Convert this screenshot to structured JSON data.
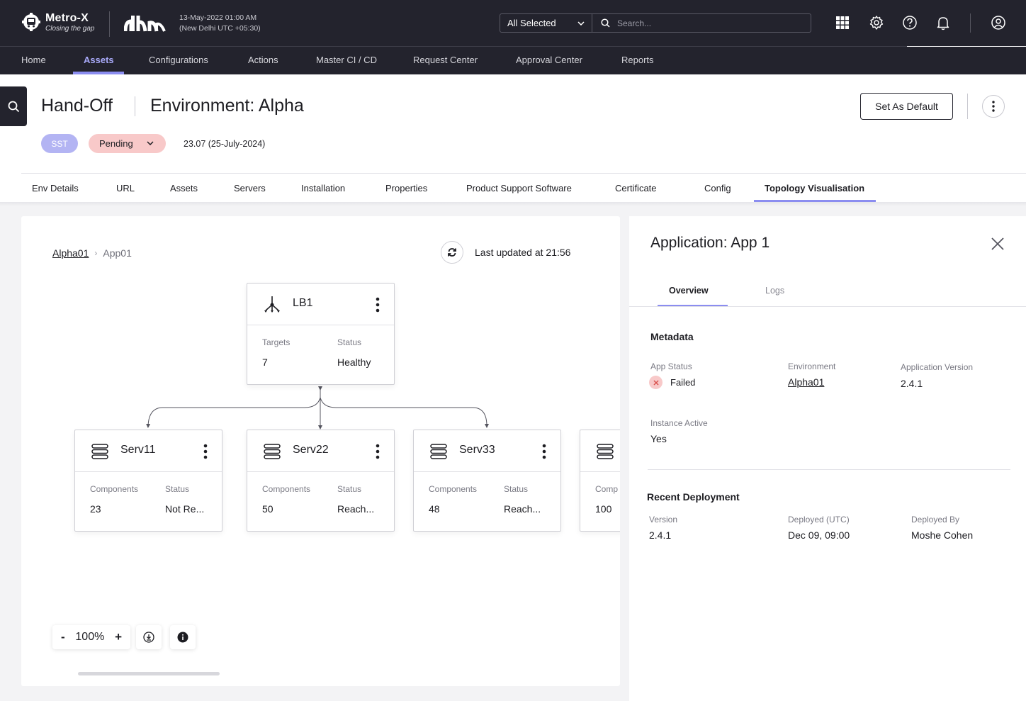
{
  "app": {
    "name": "Metro-X",
    "tagline": "Closing the gap",
    "datetime_line1": "13-May-2022 01:00 AM",
    "datetime_line2": "(New Delhi UTC +05:30)"
  },
  "search": {
    "scope_value": "All Selected",
    "placeholder": "Search..."
  },
  "top_icons": [
    "grid-icon",
    "gear-icon",
    "help-icon",
    "bell-icon",
    "user-icon"
  ],
  "nav": {
    "items": [
      {
        "label": "Home"
      },
      {
        "label": "Assets",
        "active": true
      },
      {
        "label": "Configurations"
      },
      {
        "label": "Actions"
      },
      {
        "label": "Master CI / CD"
      },
      {
        "label": "Request Center"
      },
      {
        "label": "Approval Center"
      },
      {
        "label": "Reports"
      }
    ]
  },
  "header": {
    "title": "Hand-Off",
    "subtitle": "Environment: Alpha",
    "set_default_label": "Set As Default",
    "badge_type": "SST",
    "status_value": "Pending",
    "version": "23.07 (25-July-2024)"
  },
  "tabs": [
    {
      "label": "Env Details"
    },
    {
      "label": "URL"
    },
    {
      "label": "Assets"
    },
    {
      "label": "Servers"
    },
    {
      "label": "Installation"
    },
    {
      "label": "Properties"
    },
    {
      "label": "Product Support Software"
    },
    {
      "label": "Certificate"
    },
    {
      "label": "Config"
    },
    {
      "label": "Topology Visualisation",
      "active": true
    }
  ],
  "topology": {
    "breadcrumb": {
      "root": "Alpha01",
      "current": "App01"
    },
    "last_updated": "Last updated at 21:56",
    "lb": {
      "name": "LB1",
      "label1": "Targets",
      "value1": "7",
      "label2": "Status",
      "value2": "Healthy"
    },
    "servers": [
      {
        "name": "Serv11",
        "label1": "Components",
        "value1": "23",
        "label2": "Status",
        "value2": "Not Re..."
      },
      {
        "name": "Serv22",
        "label1": "Components",
        "value1": "50",
        "label2": "Status",
        "value2": "Reach..."
      },
      {
        "name": "Serv33",
        "label1": "Components",
        "value1": "48",
        "label2": "Status",
        "value2": "Reach..."
      },
      {
        "name": "",
        "label1": "Comp",
        "value1": "100",
        "label2": "",
        "value2": ""
      }
    ],
    "zoom": {
      "minus": "-",
      "value": "100%",
      "plus": "+"
    }
  },
  "detail": {
    "title": "Application: App 1",
    "tabs": [
      {
        "label": "Overview",
        "active": true
      },
      {
        "label": "Logs"
      }
    ],
    "metadata": {
      "title": "Metadata",
      "app_status_label": "App Status",
      "app_status_value": "Failed",
      "environment_label": "Environment",
      "environment_value": "Alpha01",
      "app_version_label": "Application Version",
      "app_version_value": "2.4.1",
      "instance_label": "Instance Active",
      "instance_value": "Yes"
    },
    "deployment": {
      "title": "Recent Deployment",
      "version_label": "Version",
      "version_value": "2.4.1",
      "deployed_label": "Deployed (UTC)",
      "deployed_value": "Dec 09, 09:00",
      "by_label": "Deployed By",
      "by_value": "Moshe Cohen"
    }
  },
  "colors": {
    "topbar": "#23232d",
    "accent": "#8b8df0",
    "pending_badge": "#f8c9c9",
    "sst_badge": "#b3b4f3"
  }
}
